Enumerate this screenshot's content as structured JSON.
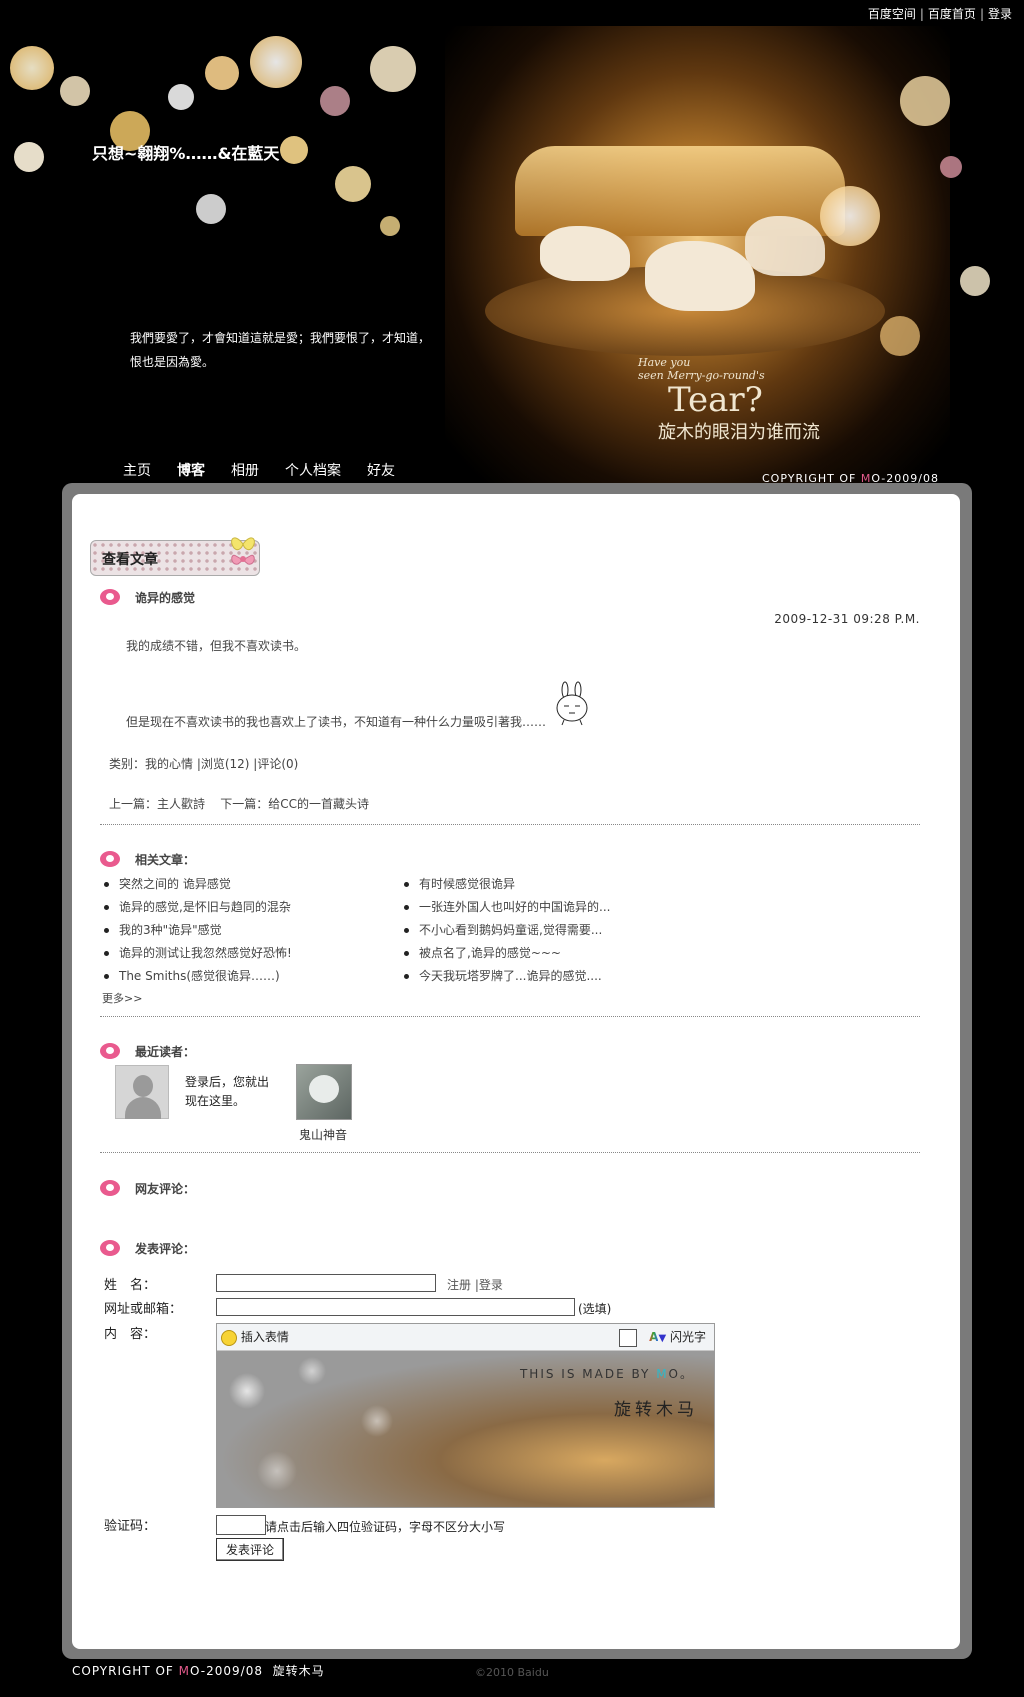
{
  "toplinks": {
    "space": "百度空间",
    "home": "百度首页",
    "login": "登录",
    "sep": "|"
  },
  "header": {
    "title": "只想~翱翔%……&在藍天",
    "description": "我們要愛了，才會知道這就是愛；我們要恨了，才知道，恨也是因為愛。",
    "art_text": {
      "line1": "Have you",
      "line2": "seen Merry-go-round's",
      "big": "Tear?",
      "cn": "旋木的眼泪为谁而流"
    },
    "copyright_prefix": "COPYRIGHT OF ",
    "copyright_m": "M",
    "copyright_suffix": "O-2009/08"
  },
  "nav": [
    "主页",
    "博客",
    "相册",
    "个人档案",
    "好友"
  ],
  "nav_active_index": 1,
  "section_title": "查看文章",
  "article": {
    "title": "诡异的感觉",
    "date": "2009-12-31 09:28 P.M.",
    "p1": "我的成绩不错，但我不喜欢读书。",
    "p2": "但是现在不喜欢读书的我也喜欢上了读书，不知道有一种什么力量吸引著我……",
    "meta": "类别：我的心情 |浏览(12) |评论(0)",
    "nav": "上一篇：主人歡詩    下一篇：给CC的一首藏头诗"
  },
  "related": {
    "heading": "相关文章：",
    "left": [
      "突然之间的 诡异感觉",
      "诡异的感觉,是怀旧与趋同的混杂",
      "我的3种\"诡异\"感觉",
      "诡异的测试让我忽然感觉好恐怖!",
      "The Smiths(感觉很诡异……)"
    ],
    "right": [
      "有时候感觉很诡异",
      "一张连外国人也叫好的中国诡异的...",
      "不小心看到鹅妈妈童谣,觉得需要...",
      "被点名了,诡异的感觉~~~",
      "今天我玩塔罗牌了...诡异的感觉...."
    ],
    "more": "更多>>"
  },
  "readers": {
    "heading": "最近读者：",
    "login_prompt_line1": "登录后，您就出",
    "login_prompt_line2": "现在这里。",
    "reader_name": "鬼山神音"
  },
  "comments": {
    "heading": "网友评论："
  },
  "post_comment": {
    "heading": "发表评论：",
    "name_label": "姓　名：",
    "register": "注册",
    "login": "登录",
    "sep": "|",
    "url_label": "网址或邮箱：",
    "optional": "(选填)",
    "content_label": "内　容：",
    "insert_emoji": "插入表情",
    "flash_text": "闪光字",
    "editor_made_prefix": "THIS IS MADE BY ",
    "editor_made_m": "M",
    "editor_made_suffix": "O。",
    "editor_cn": "旋转木马",
    "captcha_label": "验证码：",
    "captcha_hint": "请点击后输入四位验证码，字母不区分大小写",
    "submit": "发表评论"
  },
  "footer": {
    "copyright_prefix": "COPYRIGHT OF ",
    "copyright_m": "M",
    "copyright_suffix": "O-2009/08  旋转木马",
    "baidu": "©2010 Baidu"
  },
  "colors": {
    "accent_pink": "#e95a8e",
    "header_bg": "#000000",
    "frame": "#7a7a7a"
  }
}
